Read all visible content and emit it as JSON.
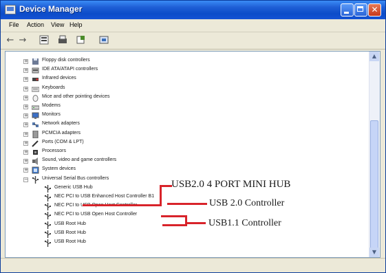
{
  "window": {
    "title": "Device Manager"
  },
  "menu": [
    "File",
    "Action",
    "View",
    "Help"
  ],
  "toolbar": [
    "back-arrow-icon",
    "forward-arrow-icon",
    "properties-icon",
    "print-icon",
    "update-icon",
    "scan-icon"
  ],
  "tree": [
    {
      "label": "Floppy disk controllers",
      "icon": "floppy-icon",
      "type": "category",
      "expander": "+"
    },
    {
      "label": "IDE ATA/ATAPI controllers",
      "icon": "ide-icon",
      "type": "category",
      "expander": "+"
    },
    {
      "label": "Infrared devices",
      "icon": "infrared-icon",
      "type": "category",
      "expander": "+"
    },
    {
      "label": "Keyboards",
      "icon": "keyboard-icon",
      "type": "category",
      "expander": "+"
    },
    {
      "label": "Mice and other pointing devices",
      "icon": "mouse-icon",
      "type": "category",
      "expander": "+"
    },
    {
      "label": "Modems",
      "icon": "modem-icon",
      "type": "category",
      "expander": "+"
    },
    {
      "label": "Monitors",
      "icon": "monitor-icon",
      "type": "category",
      "expander": "+"
    },
    {
      "label": "Network adapters",
      "icon": "network-icon",
      "type": "category",
      "expander": "+"
    },
    {
      "label": "PCMCIA adapters",
      "icon": "pcmcia-icon",
      "type": "category",
      "expander": "+"
    },
    {
      "label": "Ports (COM & LPT)",
      "icon": "port-icon",
      "type": "category",
      "expander": "+"
    },
    {
      "label": "Processors",
      "icon": "processor-icon",
      "type": "category",
      "expander": "+"
    },
    {
      "label": "Sound, video and game controllers",
      "icon": "sound-icon",
      "type": "category",
      "expander": "+"
    },
    {
      "label": "System devices",
      "icon": "system-icon",
      "type": "category",
      "expander": "+"
    },
    {
      "label": "Universal Serial Bus controllers",
      "icon": "usb-icon",
      "type": "category",
      "expander": "−"
    },
    {
      "label": "Generic USB Hub",
      "icon": "usb-icon",
      "type": "device"
    },
    {
      "label": "NEC PCI to USB Enhanced Host Controller B1",
      "icon": "usb-icon",
      "type": "device"
    },
    {
      "label": "NEC PCI to USB Open Host Controller",
      "icon": "usb-icon",
      "type": "device"
    },
    {
      "label": "NEC PCI to USB Open Host Controller",
      "icon": "usb-icon",
      "type": "device"
    },
    {
      "label": "USB Root Hub",
      "icon": "usb-icon",
      "type": "device"
    },
    {
      "label": "USB Root Hub",
      "icon": "usb-icon",
      "type": "device"
    },
    {
      "label": "USB Root Hub",
      "icon": "usb-icon",
      "type": "device"
    }
  ],
  "annotations": {
    "hub": "USB2.0 4 PORT MINI HUB",
    "usb20": "USB 2.0 Controller",
    "usb11": "USB1.1 Controller"
  },
  "colors": {
    "annotation_line": "#d8232a",
    "title_bar": "#0c4cc9"
  }
}
